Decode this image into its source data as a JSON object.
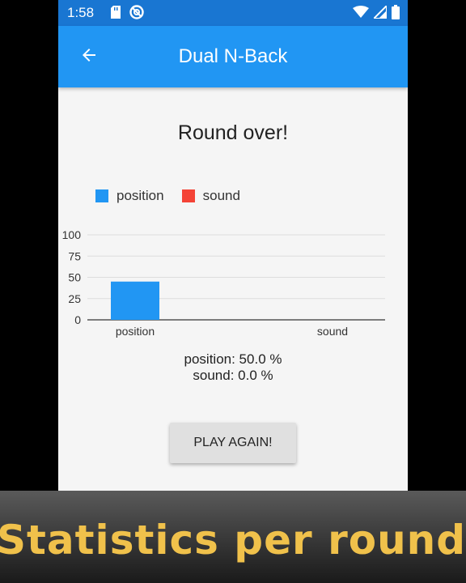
{
  "status_bar": {
    "time": "1:58",
    "icons": [
      "sd-card-icon",
      "do-not-disturb-icon",
      "wifi-icon",
      "signal-icon",
      "battery-icon"
    ]
  },
  "app_bar": {
    "title": "Dual N-Back",
    "back_icon": "arrow-back-icon",
    "color": "#2196f3"
  },
  "main": {
    "heading": "Round over!",
    "stats": {
      "position_line": "position: 50.0 %",
      "sound_line": "sound: 0.0 %"
    },
    "play_button_label": "PLAY AGAIN!"
  },
  "chart_data": {
    "type": "bar",
    "categories": [
      "position",
      "sound"
    ],
    "series": [
      {
        "name": "position",
        "color": "#2196f3",
        "values": [
          45,
          0
        ]
      },
      {
        "name": "sound",
        "color": "#f44336",
        "values": [
          0,
          0
        ]
      }
    ],
    "yticks": [
      "100",
      "75",
      "50",
      "25",
      "0"
    ],
    "ylim": [
      0,
      100
    ],
    "grid": true,
    "legend": "top-left"
  },
  "caption": "Statistics per round"
}
